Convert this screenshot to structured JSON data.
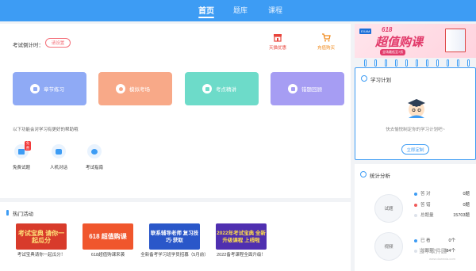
{
  "nav": {
    "items": [
      {
        "label": "首页",
        "active": true
      },
      {
        "label": "题库",
        "active": false
      },
      {
        "label": "课程",
        "active": false
      }
    ]
  },
  "main": {
    "countdown_label": "考试倒计时：",
    "set_label": "请设置",
    "links": [
      {
        "label": "天猫优惠",
        "icon": "store-icon",
        "color": "#e8453c"
      },
      {
        "label": "充值购买",
        "icon": "cart-icon",
        "color": "#f08a1c"
      }
    ],
    "cards": [
      {
        "label": "章节练习",
        "icon": "chapter-icon",
        "color": "#8faaf5"
      },
      {
        "label": "模拟考场",
        "icon": "clock-icon",
        "color": "#f8a988"
      },
      {
        "label": "考点精讲",
        "icon": "video-icon",
        "color": "#6ddbc9"
      },
      {
        "label": "错题回顾",
        "icon": "pen-icon",
        "color": "#a69df3"
      }
    ],
    "hint": "以下功能会对学习有更好的帮助哦",
    "tools": [
      {
        "label": "免费试题",
        "icon": "question-icon",
        "badge": "免费"
      },
      {
        "label": "人机对话",
        "icon": "chat-icon",
        "badge": ""
      },
      {
        "label": "考试指南",
        "icon": "compass-icon",
        "badge": ""
      }
    ]
  },
  "hot": {
    "title": "热门活动",
    "promos": [
      {
        "image_text": "考试宝典 请你一起瓜分",
        "caption": "考试宝典请你一起瓜分！",
        "bg": "#d83b2b",
        "fg": "#ffe27a"
      },
      {
        "image_text": "618 超值购课",
        "caption": "618超值购课来袭",
        "bg": "#f0562d",
        "fg": "#fff"
      },
      {
        "image_text": "联系辅导老师 复习技巧·获取",
        "caption": "全新备考学习班学员招募（5月前）",
        "bg": "#2a57c9",
        "fg": "#fff"
      },
      {
        "image_text": "2022年考试宝典 全新升级课程 上线啦",
        "caption": "2022备考课程全面升级！",
        "bg": "#4f2fb0",
        "fg": "#ffde4a"
      }
    ]
  },
  "ad": {
    "logo": "EXAM",
    "title": "618",
    "slogan": "超值购课",
    "sub": "全场最低至7折"
  },
  "plan": {
    "title": "学习计划",
    "tip": "快去愉悦制定你的学习计划吧~",
    "button": "立即定制"
  },
  "stats": {
    "title": "统计分析",
    "exam_circle": "试题",
    "video_circle": "视频",
    "rows": [
      {
        "label": "答  对",
        "value": "0题",
        "color": "#3d9cf4"
      },
      {
        "label": "答  错",
        "value": "0题",
        "color": "#f05a5a"
      },
      {
        "label": "总题量",
        "value": "15703题",
        "color": "#dde2ea"
      }
    ],
    "video_rows": [
      {
        "label": "已  看",
        "value": "0个",
        "color": "#3d9cf4"
      },
      {
        "label": "总数量",
        "value": "384个",
        "color": "#dde2ea"
      }
    ]
  },
  "watermark": {
    "name": "当下软件园",
    "sub": "www.downxia.com"
  },
  "colors": {
    "primary": "#3d9cf4",
    "danger": "#f4707a",
    "orange": "#f08a1c"
  }
}
